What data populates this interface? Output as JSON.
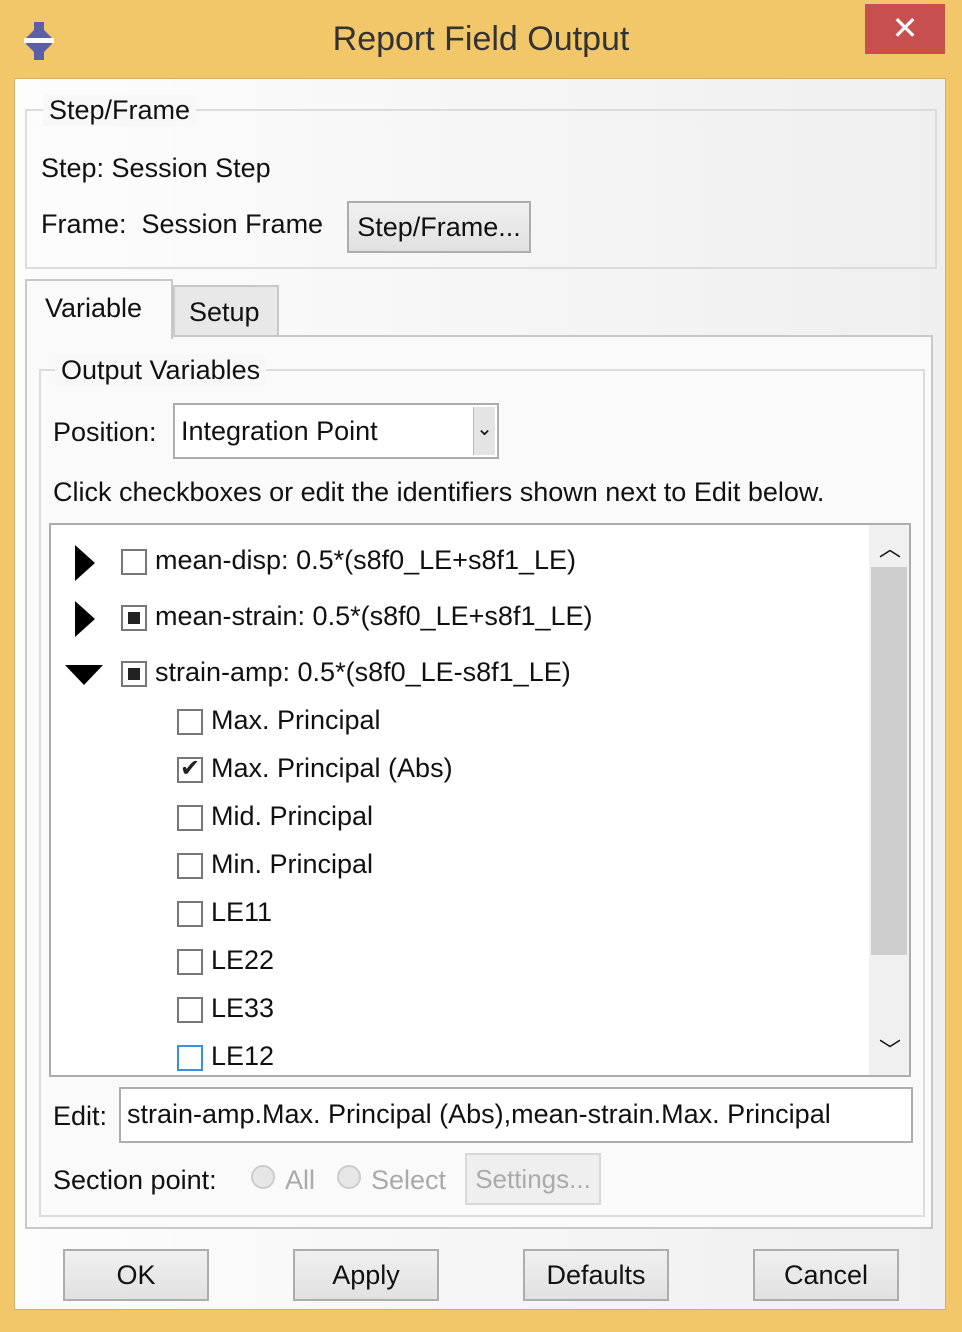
{
  "window": {
    "title": "Report Field Output",
    "close_label": "✕",
    "colors": {
      "frame": "#f1c76a",
      "close": "#c84f4f"
    }
  },
  "step_frame": {
    "legend": "Step/Frame",
    "step": "Step: Session Step",
    "frame": "Frame:  Session Frame",
    "button": "Step/Frame..."
  },
  "tabs": [
    {
      "label": "Variable",
      "active": true
    },
    {
      "label": "Setup",
      "active": false
    }
  ],
  "output_variables": {
    "legend": "Output Variables",
    "position_label": "Position:",
    "position_value": "Integration Point",
    "hint": "Click checkboxes or edit the identifiers shown next to Edit below.",
    "tree": [
      {
        "label": "mean-disp: 0.5*(s8f0_LE+s8f1_LE)",
        "expanded": false,
        "state": "unchecked"
      },
      {
        "label": "mean-strain: 0.5*(s8f0_LE+s8f1_LE)",
        "expanded": false,
        "state": "partial"
      },
      {
        "label": "strain-amp: 0.5*(s8f0_LE-s8f1_LE)",
        "expanded": true,
        "state": "partial",
        "children": [
          {
            "label": "Max. Principal",
            "checked": false
          },
          {
            "label": "Max. Principal (Abs)",
            "checked": true
          },
          {
            "label": "Mid. Principal",
            "checked": false
          },
          {
            "label": "Min. Principal",
            "checked": false
          },
          {
            "label": "LE11",
            "checked": false
          },
          {
            "label": "LE22",
            "checked": false
          },
          {
            "label": "LE33",
            "checked": false
          },
          {
            "label": "LE12",
            "checked": false
          }
        ]
      }
    ],
    "edit_label": "Edit:",
    "edit_value": "strain-amp.Max. Principal (Abs),mean-strain.Max. Principal",
    "section_point_label": "Section point:",
    "section_all": "All",
    "section_select": "Select",
    "settings_button": "Settings..."
  },
  "buttons": {
    "ok": "OK",
    "apply": "Apply",
    "defaults": "Defaults",
    "cancel": "Cancel"
  }
}
